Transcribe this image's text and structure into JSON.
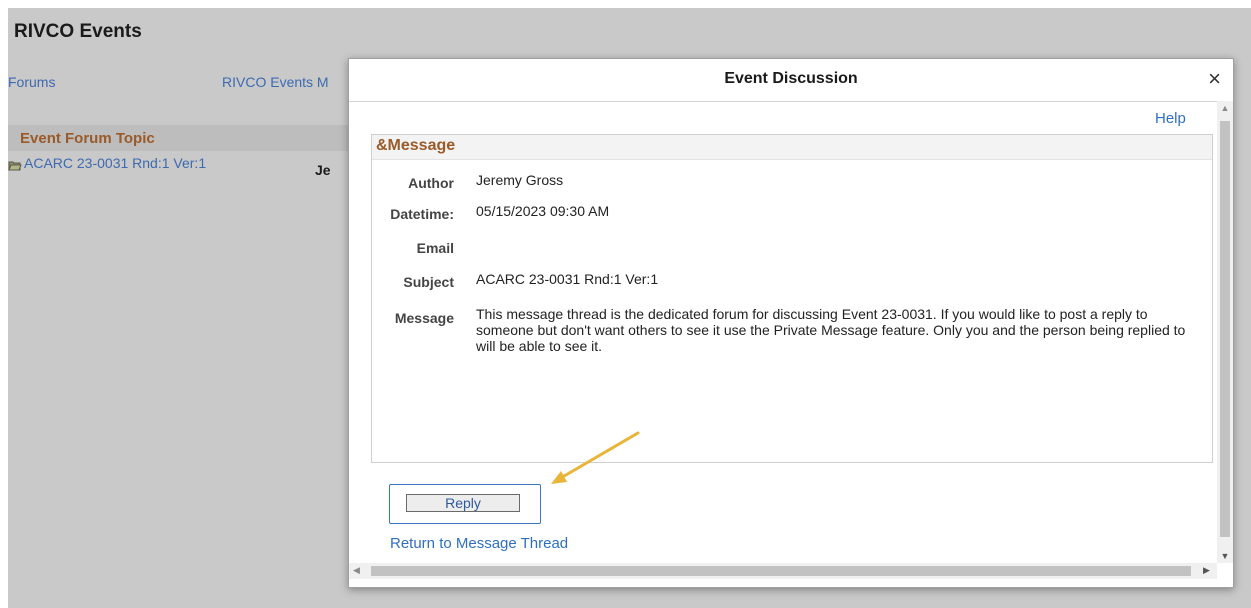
{
  "background": {
    "title": "RIVCO Events",
    "nav": {
      "forums": "Forums",
      "rivco_events": "RIVCO Events M"
    },
    "topic_header": "Event Forum Topic",
    "topic_link": "ACARC 23-0031 Rnd:1 Ver:1",
    "partial_text": "Je"
  },
  "modal": {
    "title": "Event Discussion",
    "close_glyph": "×",
    "help_label": "Help",
    "message_section": {
      "header": "&Message",
      "fields": {
        "author": {
          "label": "Author",
          "value": "Jeremy Gross"
        },
        "datetime": {
          "label": "Datetime:",
          "value": "05/15/2023 09:30 AM"
        },
        "email": {
          "label": "Email",
          "value": ""
        },
        "subject": {
          "label": "Subject",
          "value": "ACARC 23-0031 Rnd:1 Ver:1"
        },
        "message": {
          "label": "Message",
          "value": "This message thread is the dedicated forum for discussing Event 23-0031.  If you would like to post a reply to someone but don't want others to see it use the Private Message feature.  Only you and the person being replied to will be able to see it."
        }
      }
    },
    "reply_label": "Reply",
    "return_link": "Return to Message Thread"
  },
  "colors": {
    "accent_link": "#2f6fc0",
    "section_header": "#9a5a2a",
    "annotation_arrow": "#e8b53a",
    "overlay": "#c9c9c9"
  },
  "icons": {
    "close": "close-icon",
    "folder": "folder-icon",
    "scroll_up": "scroll-up-icon",
    "scroll_down": "scroll-down-icon",
    "scroll_left": "scroll-left-icon",
    "scroll_right": "scroll-right-icon",
    "annotation": "annotation-arrow-icon"
  }
}
